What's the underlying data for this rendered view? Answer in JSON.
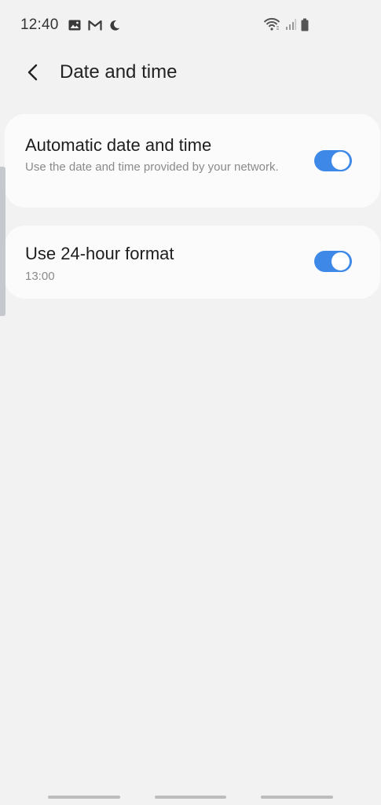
{
  "status_bar": {
    "time": "12:40",
    "left_icons": [
      "gallery-icon",
      "gmail-icon",
      "do-not-disturb-moon-icon"
    ],
    "right_icons": [
      "wifi-icon",
      "signal-icon",
      "battery-icon"
    ]
  },
  "header": {
    "title": "Date and time",
    "back_icon": "back-arrow-icon"
  },
  "settings": {
    "automatic": {
      "title": "Automatic date and time",
      "subtitle": "Use the date and time provided by your network.",
      "enabled": true
    },
    "hour24": {
      "title": "Use 24-hour format",
      "subtitle": "13:00",
      "enabled": true
    }
  },
  "colors": {
    "accent": "#3e88e8",
    "background": "#f2f2f2",
    "card": "#fbfbfb"
  }
}
